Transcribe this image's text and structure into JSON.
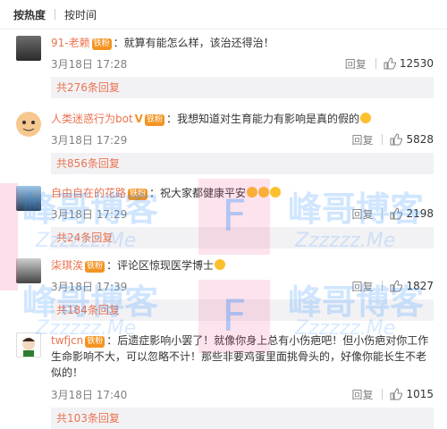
{
  "sort": {
    "hot": "按热度",
    "time": "按时间"
  },
  "comments": [
    {
      "user": "91-老赖",
      "badge": "铁粉",
      "text": "：就算有能怎么样，该治还得治！",
      "time": "3月18日 17:28",
      "reply": "回复",
      "likes": "12530",
      "more": "共276条回复"
    },
    {
      "user": "人类迷惑行为bot",
      "badge": "铁粉",
      "text": "：我想知道对生育能力有影响是真的假的",
      "time": "3月18日 17:29",
      "reply": "回复",
      "likes": "5828",
      "more": "共856条回复"
    },
    {
      "user": "自由自在的花路",
      "badge": "铁粉",
      "text": "：祝大家都健康平安",
      "time": "3月18日 17:29",
      "reply": "回复",
      "likes": "2198",
      "more": "共24条回复"
    },
    {
      "user": "柒琪涘",
      "badge": "铁粉",
      "text": "：评论区惊现医学博士",
      "time": "3月18日 17:39",
      "reply": "回复",
      "likes": "1827",
      "more": "共184条回复"
    },
    {
      "user": "twfjcn",
      "badge": "铁粉",
      "text": "：后遗症影响小罢了！就像你身上总有小伤疤吧！但小伤疤对你工作生命影响不大，可以忽略不计！那些非要鸡蛋里面挑骨头的，好像你能长生不老似的！",
      "time": "3月18日 17:40",
      "reply": "回复",
      "likes": "1015",
      "more": "共103条回复"
    }
  ],
  "watermark": {
    "brand": "峰哥博客",
    "url": "Zzzzzz.Me",
    "letter": "F"
  },
  "colors": {
    "accent": "#eb7350",
    "gray": "#808080",
    "badge": "#f39422",
    "bar": "#f2f2f5"
  }
}
